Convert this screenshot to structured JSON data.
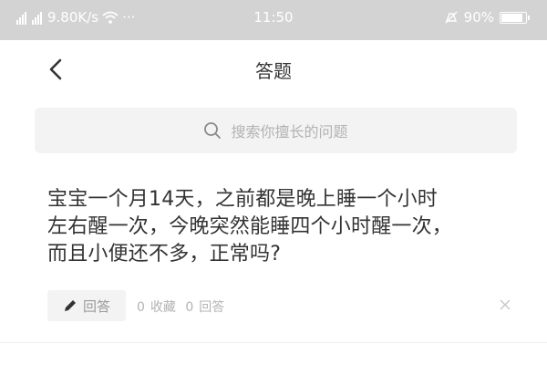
{
  "status_bar": {
    "signal_1_label": "⁴⁶",
    "signal_2_label": "²⁶",
    "network_speed": "9.80K/s",
    "more_dots": "···",
    "time": "11:50",
    "battery_percent": "90%",
    "battery_level": 0.9
  },
  "nav": {
    "back_icon": "chevron-left-icon",
    "title": "答题"
  },
  "search": {
    "icon": "search-icon",
    "placeholder": "搜索你擅长的问题"
  },
  "question": {
    "lines": [
      "宝宝一个月14天，之前都是晚上睡一个小时",
      "左右醒一次，今晚突然能睡四个小时醒一次，",
      "而且小便还不多，正常吗?"
    ],
    "answer_button_label": "回答",
    "answer_button_icon": "pencil-icon",
    "favorites_count": "0",
    "favorites_label": "收藏",
    "answers_count": "0",
    "answers_label": "回答",
    "dismiss_icon": "close-icon"
  }
}
